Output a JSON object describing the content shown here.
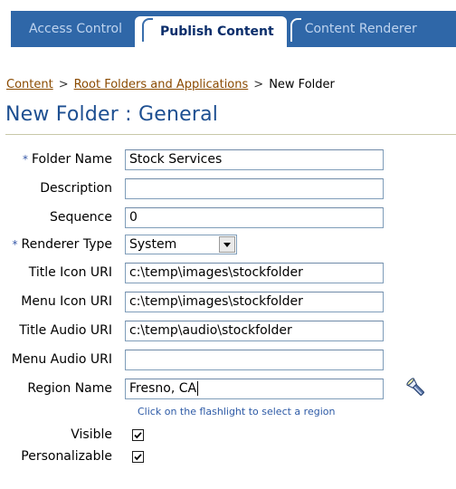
{
  "tabs": [
    {
      "label": "Access Control",
      "active": false
    },
    {
      "label": "Publish Content",
      "active": true
    },
    {
      "label": "Content Renderer",
      "active": false
    }
  ],
  "breadcrumb": {
    "items": [
      "Content",
      "Root Folders and Applications",
      "New Folder"
    ],
    "separator": ">"
  },
  "page": {
    "title": "New Folder : General"
  },
  "form": {
    "required_marker": "*",
    "folder_name": {
      "label": "Folder Name",
      "value": "Stock Services"
    },
    "description": {
      "label": "Description",
      "value": ""
    },
    "sequence": {
      "label": "Sequence",
      "value": "0"
    },
    "renderer_type": {
      "label": "Renderer Type",
      "value": "System"
    },
    "title_icon_uri": {
      "label": "Title Icon URI",
      "value": "c:\\temp\\images\\stockfolder"
    },
    "menu_icon_uri": {
      "label": "Menu Icon URI",
      "value": "c:\\temp\\images\\stockfolder"
    },
    "title_audio_uri": {
      "label": "Title Audio URI",
      "value": "c:\\temp\\audio\\stockfolder"
    },
    "menu_audio_uri": {
      "label": "Menu Audio URI",
      "value": ""
    },
    "region_name": {
      "label": "Region Name",
      "value": "Fresno, CA"
    },
    "region_helper": "Click on the flashlight to select a region",
    "visible": {
      "label": "Visible",
      "checked": true
    },
    "personalizable": {
      "label": "Personalizable",
      "checked": true
    }
  },
  "colors": {
    "tab_bar": "#2f67a8",
    "title": "#1d4f91",
    "link": "#8a4a00",
    "helper": "#2d5aa6"
  }
}
